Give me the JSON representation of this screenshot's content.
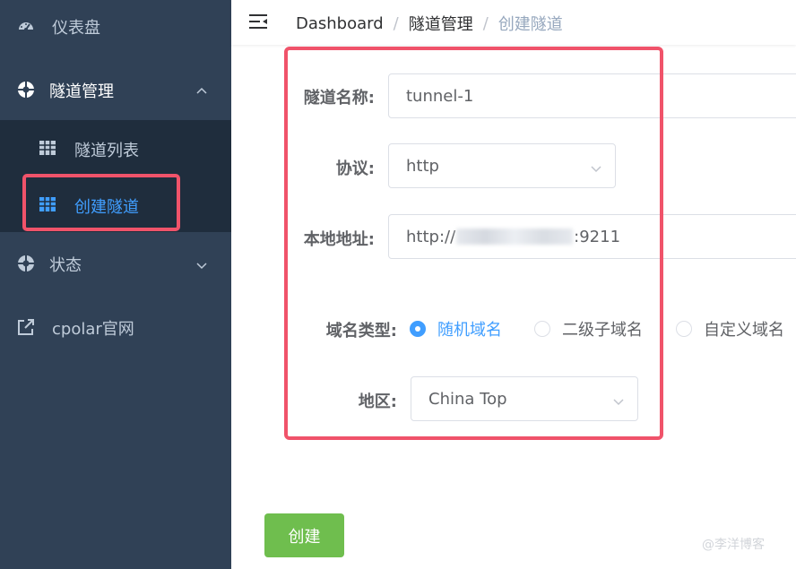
{
  "sidebar": {
    "items": [
      {
        "label": "仪表盘",
        "icon": "dashboard-icon"
      },
      {
        "label": "隧道管理",
        "icon": "tunnel-management-icon",
        "expanded": true
      },
      {
        "label": "状态",
        "icon": "status-icon",
        "expanded": false
      },
      {
        "label": "cpolar官网",
        "icon": "external-link-icon"
      }
    ],
    "submenu": [
      {
        "label": "隧道列表",
        "icon": "table-icon",
        "active": false
      },
      {
        "label": "创建隧道",
        "icon": "table-icon",
        "active": true
      }
    ]
  },
  "header": {
    "menu_icon": "hamburger-icon",
    "breadcrumb": [
      "Dashboard",
      "隧道管理",
      "创建隧道"
    ],
    "separator": "/"
  },
  "form": {
    "name": {
      "label": "隧道名称:",
      "value": "tunnel-1"
    },
    "protocol": {
      "label": "协议:",
      "value": "http"
    },
    "local_address": {
      "label": "本地地址:",
      "prefix": "http://",
      "suffix": ":9211"
    },
    "domain_type": {
      "label": "域名类型:",
      "options": [
        "随机域名",
        "二级子域名",
        "自定义域名"
      ],
      "selected": "随机域名"
    },
    "region": {
      "label": "地区:",
      "value": "China Top"
    }
  },
  "actions": {
    "create_label": "创建"
  },
  "watermark": "@李洋博客",
  "colors": {
    "sidebar_bg": "#304156",
    "submenu_bg": "#1f2d3d",
    "active_text": "#409eff",
    "create_button": "#6fbe4e",
    "highlight_border": "#f0536a"
  }
}
